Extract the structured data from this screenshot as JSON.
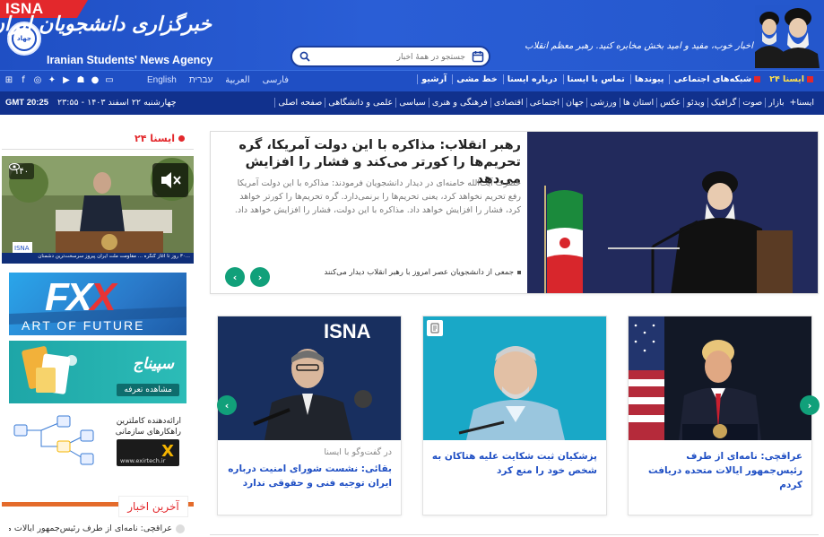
{
  "header": {
    "isna_tag": "ISNA",
    "seal_text": "جهاد",
    "brand_fa": "خبرگزاری دانشجویان ایران ، ایسنا",
    "brand_en": "Iranian Students' News Agency",
    "tagline": "اخبار خوب، مفید و امید بخش مخابره کنید. رهبر معظم انقلاب",
    "search_placeholder": "جستجو در همهٔ اخبار"
  },
  "social_icons": [
    "windows-icon",
    "facebook-icon",
    "instagram-icon",
    "twitter-icon",
    "youtube-icon",
    "android-icon",
    "apple-icon",
    "desktop-icon"
  ],
  "languages": [
    "English",
    "עברית",
    "العربية",
    "فارسی"
  ],
  "top_links": [
    "آرشیو",
    "خط مشی",
    "درباره ایسنا",
    "تماس با ایسنا",
    "پیوندها",
    "شبکه‌های اجتماعی",
    "ایسنا ۲۴"
  ],
  "navbar": {
    "gmt": "GMT 20:25",
    "date": "چهارشنبه ۲۲ اسفند ۱۴۰۳ - ۲۳:۵۵",
    "items": [
      "صفحه اصلی",
      "علمی و دانشگاهی",
      "سیاسی",
      "فرهنگی و هنری",
      "اقتصادی",
      "اجتماعی",
      "جهان",
      "ورزشی",
      "استان ها",
      "عکس",
      "ویدئو",
      "گرافیک",
      "صوت",
      "بازار",
      "ایسنا+"
    ]
  },
  "sidebar": {
    "section_title": "ایسنا ۲۴",
    "video_views": "۱۴۰",
    "video_ticker": "...۳۰ روز تا آغاز گنگره ... مقاومت ملت ایران پیروز سرسخت‌ترین دشمنان است",
    "banner1": {
      "brand_fx": "FX",
      "brand_x": "X",
      "sub": "ART OF FUTURE"
    },
    "banner2": {
      "title": "سپیناج",
      "button": "مشاهده تعرفه"
    },
    "banner3": {
      "text": "ارائه‌دهنده کاملترین راهکارهای سازمانی",
      "logo": "X",
      "url": "www.exirtech.ir"
    },
    "latest_title": "آخرین اخبار",
    "latest_item": "عراقچی: نامه‌ای از طرف رئیس‌جمهور ایالات متحده..."
  },
  "hero": {
    "title": "رهبر انقلاب: مذاکره با این دولت آمریکا، گره تحریم‌ها را کورتر می‌کند و فشار را افزایش می‌دهد",
    "body": "حضرت آیت‌الله خامنه‌ای در دیدار دانشجویان فرمودند: مذاکره با این دولت آمریکا رفع تحریم نخواهد کرد، یعنی تحریم‌ها را برنمی‌دارد. گره تحریم‌ها را کورتر خواهد کرد، فشار را افزایش خواهد داد. مذاکره با این دولت، فشار را افزایش خواهد داد.",
    "caption": "جمعی از دانشجویان عصر امروز با رهبر انقلاب دیدار می‌کنند",
    "prev": "‹",
    "next": "›"
  },
  "cards": [
    {
      "kicker": "در گفت‌وگو با ایسنا",
      "title": "بقائی: نشست شورای امنیت درباره ایران توجیه فنی و حقوقی ندارد",
      "watermark": "ISNA"
    },
    {
      "kicker": "",
      "title": "پزشکیان ثبت شکایت علیه هتاکان به شخص خود را منع کرد"
    },
    {
      "kicker": "",
      "title": "عراقچی: نامه‌ای از طرف رئیس‌جمهور ایالات متحده دریافت کردم"
    }
  ],
  "card_prev": "‹",
  "card_next": "›",
  "colors": {
    "header_blue": "#2457cc",
    "nav_dark": "#11318d",
    "accent_red": "#e3282c",
    "link_blue": "#1f4fc4",
    "arrow_green": "#11a07a"
  }
}
